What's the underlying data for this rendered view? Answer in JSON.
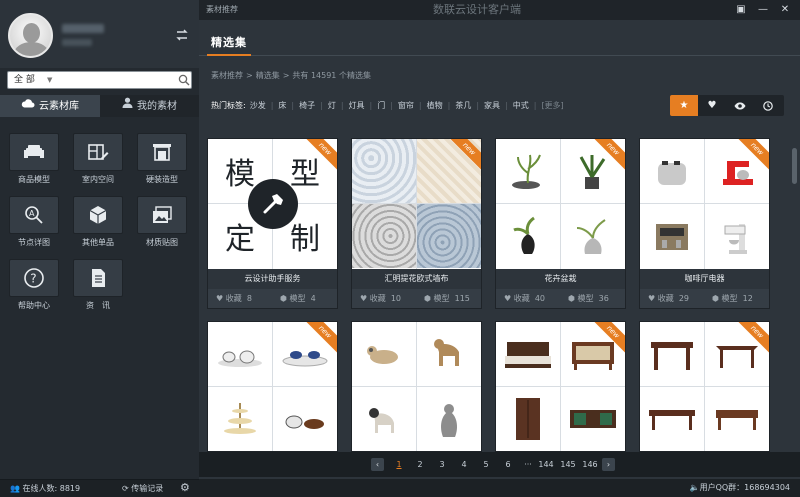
{
  "window": {
    "crumb": "素材推荐",
    "title": "数联云设计客户端"
  },
  "search": {
    "category": "全 部",
    "placeholder": ""
  },
  "tabs": [
    {
      "label": "云素材库"
    },
    {
      "label": "我的素材"
    }
  ],
  "tiles": [
    {
      "label": "商品模型",
      "icon": "sofa-icon"
    },
    {
      "label": "室内空间",
      "icon": "room-icon"
    },
    {
      "label": "硬装造型",
      "icon": "fireplace-icon"
    },
    {
      "label": "节点详图",
      "icon": "node-detail-icon"
    },
    {
      "label": "其他单品",
      "icon": "cube-icon"
    },
    {
      "label": "材质贴图",
      "icon": "texture-icon"
    },
    {
      "label": "帮助中心",
      "icon": "help-icon"
    },
    {
      "label": "资　讯",
      "icon": "news-icon"
    }
  ],
  "sidebar_footer": {
    "online": "在线人数: 8819",
    "transfer": "传输记录"
  },
  "section": {
    "title": "精选集"
  },
  "breadcrumb": {
    "items": [
      "素材推荐",
      "精选集"
    ],
    "count_text": "共有 14591 个精选集"
  },
  "hot_tags": {
    "label": "热门标签:",
    "tags": [
      "沙发",
      "床",
      "椅子",
      "灯",
      "灯具",
      "门",
      "窗帘",
      "植物",
      "茶几",
      "家具",
      "中式"
    ],
    "more": "[更多]"
  },
  "sort_buttons": [
    {
      "name": "star-icon",
      "active": true
    },
    {
      "name": "heart-icon",
      "active": false
    },
    {
      "name": "eye-icon",
      "active": false
    },
    {
      "name": "clock-icon",
      "active": false
    }
  ],
  "badge_new": "new",
  "cards": [
    {
      "title": "云设计助手服务",
      "fav_label": "收藏",
      "fav": "8",
      "model_label": "模型",
      "models": "4",
      "chars": [
        "模",
        "型",
        "定",
        "制"
      ]
    },
    {
      "title": "汇明提花欧式墙布",
      "fav_label": "收藏",
      "fav": "10",
      "model_label": "模型",
      "models": "115"
    },
    {
      "title": "花卉盆栽",
      "fav_label": "收藏",
      "fav": "40",
      "model_label": "模型",
      "models": "36"
    },
    {
      "title": "咖啡厅电器",
      "fav_label": "收藏",
      "fav": "29",
      "model_label": "模型",
      "models": "12"
    }
  ],
  "pagination": {
    "pages": [
      "1",
      "2",
      "3",
      "4",
      "5",
      "6",
      "···",
      "144",
      "145",
      "146"
    ],
    "current": "1"
  },
  "status": {
    "qq": "用户QQ群：168694304"
  },
  "colors": {
    "accent": "#e67e22",
    "sidebar": "#242a30",
    "main": "#2d343b"
  }
}
